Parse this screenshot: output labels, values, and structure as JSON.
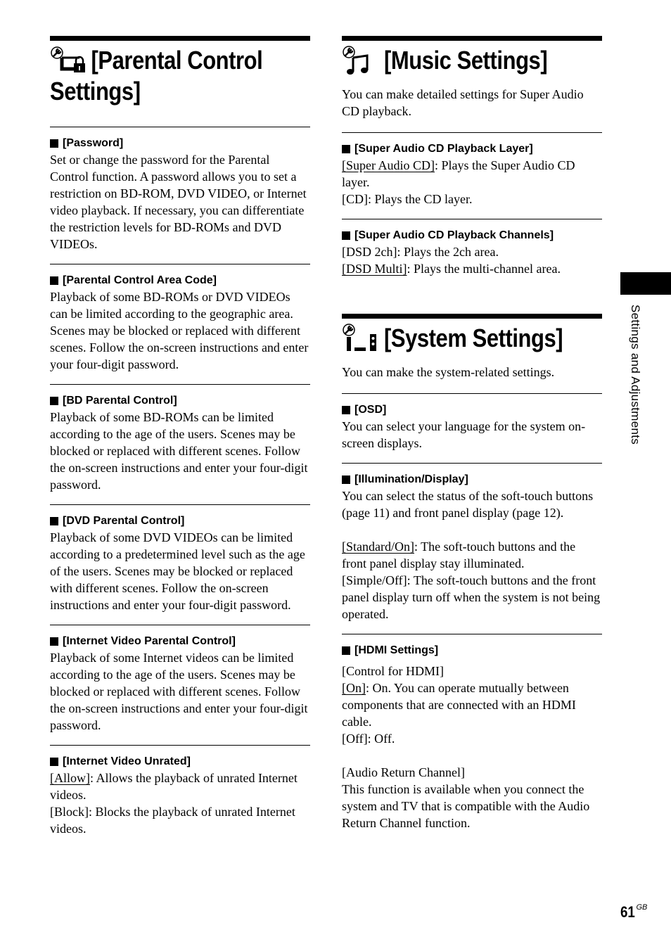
{
  "side_tab": {
    "label": "Settings and Adjustments"
  },
  "page_number": {
    "number": "61",
    "suffix": "GB"
  },
  "parental": {
    "title_line1": "[Parental Control",
    "title_line2": "Settings]",
    "icon": "wrench-monitor-lock-icon",
    "items": [
      {
        "heading": "[Password]",
        "text": "Set or change the password for the Parental Control function. A password allows you to set a restriction on BD-ROM, DVD VIDEO, or Internet video playback. If necessary, you can differentiate the restriction levels for BD-ROMs and DVD VIDEOs."
      },
      {
        "heading": "[Parental Control Area Code]",
        "text": "Playback of some BD-ROMs or DVD VIDEOs can be limited according to the geographic area. Scenes may be blocked or replaced with different scenes. Follow the on-screen instructions and enter your four-digit password."
      },
      {
        "heading": "[BD Parental Control]",
        "text": "Playback of some BD-ROMs can be limited according to the age of the users. Scenes may be blocked or replaced with different scenes. Follow the on-screen instructions and enter your four-digit password."
      },
      {
        "heading": "[DVD Parental Control]",
        "text": "Playback of some DVD VIDEOs can be limited according to a predetermined level such as the age of the users. Scenes may be blocked or replaced with different scenes. Follow the on-screen instructions and enter your four-digit password."
      },
      {
        "heading": "[Internet Video Parental Control]",
        "text": "Playback of some Internet videos can be limited according to the age of the users. Scenes may be blocked or replaced with different scenes. Follow the on-screen instructions and enter your four-digit password."
      },
      {
        "heading": "[Internet Video Unrated]",
        "opt1_label": "[Allow]",
        "opt1_text": ": Allows the playback of unrated Internet videos.",
        "opt2_label": "[Block]",
        "opt2_text": ": Blocks the playback of unrated Internet videos."
      }
    ]
  },
  "music": {
    "title": "[Music Settings]",
    "icon": "wrench-music-note-icon",
    "intro": "You can make detailed settings for Super Audio CD playback.",
    "layer": {
      "heading": "[Super Audio CD Playback Layer]",
      "opt1_label": "[Super Audio CD]",
      "opt1_text": ": Plays the Super Audio CD layer.",
      "opt2_label": "[CD]",
      "opt2_text": ": Plays the CD layer."
    },
    "channels": {
      "heading": "[Super Audio CD Playback Channels]",
      "opt1_label": "[DSD 2ch]",
      "opt1_text": ": Plays the 2ch area.",
      "opt2_label": "[DSD Multi]",
      "opt2_text": ": Plays the multi-channel area."
    }
  },
  "system": {
    "title": "[System Settings]",
    "icon": "wrench-system-icon",
    "intro": "You can make the system-related settings.",
    "osd": {
      "heading": "[OSD]",
      "text": "You can select your language for the system on-screen displays."
    },
    "illumination": {
      "heading": "[Illumination/Display]",
      "text": "You can select the status of the soft-touch buttons (page 11) and front panel display (page 12).",
      "opt1_label": "[Standard/On]",
      "opt1_text": ": The soft-touch buttons and the front panel display stay illuminated.",
      "opt2_label": "[Simple/Off]",
      "opt2_text": ": The soft-touch buttons and the front panel display turn off when the system is not being operated."
    },
    "hdmi": {
      "heading": "[HDMI Settings]",
      "sub1": "[Control for HDMI]",
      "opt1_label": "[On]",
      "opt1_text": ": On. You can operate mutually between components that are connected with an HDMI cable.",
      "opt2_label": "[Off]",
      "opt2_text": ": Off.",
      "sub2": "[Audio Return Channel]",
      "sub2_text": "This function is available when you connect the system and TV that is compatible with the Audio Return Channel function."
    }
  }
}
